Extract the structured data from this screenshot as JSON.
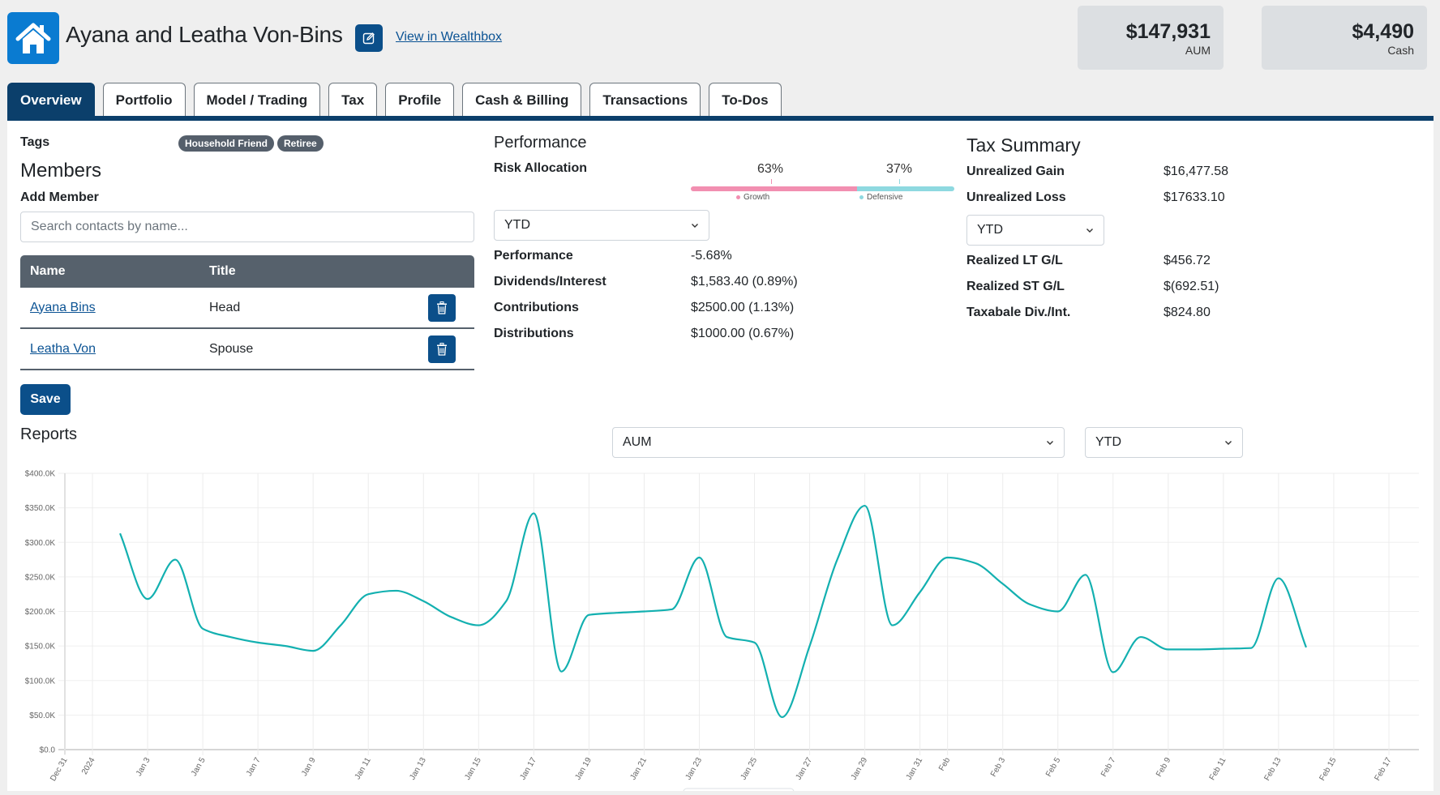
{
  "header": {
    "title": "Ayana and Leatha Von-Bins",
    "wealthbox_link": "View in Wealthbox",
    "icons": {
      "home": "house-icon",
      "edit": "edit-square-icon"
    },
    "stats": [
      {
        "value": "$147,931",
        "label": "AUM"
      },
      {
        "value": "$4,490",
        "label": "Cash"
      }
    ]
  },
  "tabs": [
    {
      "label": "Overview",
      "active": true
    },
    {
      "label": "Portfolio",
      "active": false
    },
    {
      "label": "Model / Trading",
      "active": false
    },
    {
      "label": "Tax",
      "active": false
    },
    {
      "label": "Profile",
      "active": false
    },
    {
      "label": "Cash & Billing",
      "active": false
    },
    {
      "label": "Transactions",
      "active": false
    },
    {
      "label": "To-Dos",
      "active": false
    }
  ],
  "members": {
    "tags_label": "Tags",
    "tags": [
      "Household Friend",
      "Retiree"
    ],
    "title": "Members",
    "add_member_label": "Add Member",
    "search_placeholder": "Search contacts by name...",
    "columns": [
      "Name",
      "Title"
    ],
    "rows": [
      {
        "name": "Ayana Bins",
        "title": "Head"
      },
      {
        "name": "Leatha Von",
        "title": "Spouse"
      }
    ],
    "save_label": "Save"
  },
  "performance": {
    "title": "Performance",
    "risk_label": "Risk Allocation",
    "risk": [
      {
        "name": "Growth",
        "percent": 63,
        "label": "63%",
        "color": "#f28fb1"
      },
      {
        "name": "Defensive",
        "percent": 37,
        "label": "37%",
        "color": "#8ed9e0"
      }
    ],
    "period": "YTD",
    "rows": [
      {
        "label": "Performance",
        "value": "-5.68%"
      },
      {
        "label": "Dividends/Interest",
        "value": "$1,583.40 (0.89%)"
      },
      {
        "label": "Contributions",
        "value": "$2500.00 (1.13%)"
      },
      {
        "label": "Distributions",
        "value": "$1000.00 (0.67%)"
      }
    ]
  },
  "tax": {
    "title": "Tax Summary",
    "unrealized": [
      {
        "label": "Unrealized Gain",
        "value": "$16,477.58"
      },
      {
        "label": "Unrealized Loss",
        "value": "$17633.10"
      }
    ],
    "period": "YTD",
    "realized": [
      {
        "label": "Realized LT G/L",
        "value": "$456.72"
      },
      {
        "label": "Realized ST G/L",
        "value": "$(692.51)"
      },
      {
        "label": "Taxabale Div./Int.",
        "value": "$824.80"
      }
    ]
  },
  "reports": {
    "title": "Reports",
    "metric_select": "AUM",
    "period_select": "YTD"
  },
  "colors": {
    "brand_dark": "#0b3f6b",
    "button": "#0b4f8a",
    "home_tile": "#0a7bd1",
    "line": "#13b0b0"
  },
  "chart_data": {
    "type": "line",
    "title": "",
    "xlabel": "",
    "ylabel": "",
    "ylim": [
      0,
      400000
    ],
    "y_ticks": [
      "$0.0",
      "$50.0K",
      "$100.0K",
      "$150.0K",
      "$200.0K",
      "$250.0K",
      "$300.0K",
      "$350.0K",
      "$400.0K"
    ],
    "x_range_days": [
      0,
      48
    ],
    "x_ticks": [
      {
        "day": 0,
        "label": "Dec 31"
      },
      {
        "day": 1,
        "label": "2024"
      },
      {
        "day": 3,
        "label": "Jan 3"
      },
      {
        "day": 5,
        "label": "Jan 5"
      },
      {
        "day": 7,
        "label": "Jan 7"
      },
      {
        "day": 9,
        "label": "Jan 9"
      },
      {
        "day": 11,
        "label": "Jan 11"
      },
      {
        "day": 13,
        "label": "Jan 13"
      },
      {
        "day": 15,
        "label": "Jan 15"
      },
      {
        "day": 17,
        "label": "Jan 17"
      },
      {
        "day": 19,
        "label": "Jan 19"
      },
      {
        "day": 21,
        "label": "Jan 21"
      },
      {
        "day": 23,
        "label": "Jan 23"
      },
      {
        "day": 25,
        "label": "Jan 25"
      },
      {
        "day": 27,
        "label": "Jan 27"
      },
      {
        "day": 29,
        "label": "Jan 29"
      },
      {
        "day": 31,
        "label": "Jan 31"
      },
      {
        "day": 32,
        "label": "Feb"
      },
      {
        "day": 34,
        "label": "Feb 3"
      },
      {
        "day": 36,
        "label": "Feb 5"
      },
      {
        "day": 38,
        "label": "Feb 7"
      },
      {
        "day": 40,
        "label": "Feb 9"
      },
      {
        "day": 42,
        "label": "Feb 11"
      },
      {
        "day": 44,
        "label": "Feb 13"
      },
      {
        "day": 46,
        "label": "Feb 15"
      },
      {
        "day": 48,
        "label": "Feb 17"
      }
    ],
    "grid": true,
    "legend": "none",
    "series": [
      {
        "name": "AUM",
        "points": [
          {
            "day": 2.0,
            "value": 313000
          },
          {
            "day": 3.0,
            "value": 218000
          },
          {
            "day": 4.0,
            "value": 275000
          },
          {
            "day": 5.0,
            "value": 175000
          },
          {
            "day": 6.0,
            "value": 163000
          },
          {
            "day": 7.0,
            "value": 155000
          },
          {
            "day": 8.0,
            "value": 150000
          },
          {
            "day": 9.0,
            "value": 143000
          },
          {
            "day": 10.0,
            "value": 180000
          },
          {
            "day": 11.0,
            "value": 225000
          },
          {
            "day": 12.0,
            "value": 230000
          },
          {
            "day": 13.0,
            "value": 215000
          },
          {
            "day": 14.0,
            "value": 192000
          },
          {
            "day": 15.0,
            "value": 180000
          },
          {
            "day": 16.0,
            "value": 215000
          },
          {
            "day": 17.0,
            "value": 342000
          },
          {
            "day": 18.0,
            "value": 113000
          },
          {
            "day": 19.0,
            "value": 195000
          },
          {
            "day": 20.0,
            "value": 198000
          },
          {
            "day": 21.0,
            "value": 200000
          },
          {
            "day": 22.0,
            "value": 203000
          },
          {
            "day": 23.0,
            "value": 278000
          },
          {
            "day": 24.0,
            "value": 163000
          },
          {
            "day": 25.0,
            "value": 155000
          },
          {
            "day": 26.0,
            "value": 47000
          },
          {
            "day": 27.0,
            "value": 150000
          },
          {
            "day": 28.0,
            "value": 275000
          },
          {
            "day": 29.0,
            "value": 353000
          },
          {
            "day": 30.0,
            "value": 180000
          },
          {
            "day": 31.0,
            "value": 228000
          },
          {
            "day": 32.0,
            "value": 278000
          },
          {
            "day": 33.0,
            "value": 270000
          },
          {
            "day": 34.0,
            "value": 240000
          },
          {
            "day": 35.0,
            "value": 210000
          },
          {
            "day": 36.0,
            "value": 200000
          },
          {
            "day": 37.0,
            "value": 253000
          },
          {
            "day": 38.0,
            "value": 112000
          },
          {
            "day": 39.0,
            "value": 163000
          },
          {
            "day": 40.0,
            "value": 145000
          },
          {
            "day": 41.0,
            "value": 145000
          },
          {
            "day": 42.0,
            "value": 146000
          },
          {
            "day": 43.0,
            "value": 147000
          },
          {
            "day": 44.0,
            "value": 248000
          },
          {
            "day": 45.0,
            "value": 148000
          }
        ]
      }
    ]
  }
}
